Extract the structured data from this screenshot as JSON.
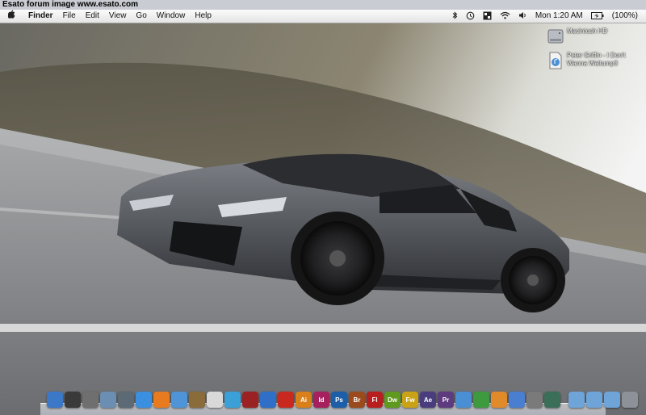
{
  "watermark": "Esato forum image www.esato.com",
  "menubar": {
    "apple": "",
    "app_name": "Finder",
    "menus": [
      "File",
      "Edit",
      "View",
      "Go",
      "Window",
      "Help"
    ],
    "clock": "Mon 1:20 AM",
    "battery": "(100%)"
  },
  "desktop": {
    "icons": [
      {
        "label": "Macintosh HD",
        "icon": "hard-drive-icon"
      },
      {
        "label": "Peter Griffin - I Don't Wanna Waltump3",
        "icon": "audio-file-icon"
      }
    ]
  },
  "dock": {
    "apps": [
      {
        "name": "finder-icon",
        "text": "",
        "color": "#3b78c8"
      },
      {
        "name": "dashboard-icon",
        "text": "",
        "color": "#3a3a3a"
      },
      {
        "name": "system-preferences-icon",
        "text": "",
        "color": "#6f6f6f"
      },
      {
        "name": "preview-icon",
        "text": "",
        "color": "#6b8fb3"
      },
      {
        "name": "application-icon",
        "text": "",
        "color": "#5b6a74"
      },
      {
        "name": "safari-icon",
        "text": "",
        "color": "#3a8fe0"
      },
      {
        "name": "firefox-icon",
        "text": "",
        "color": "#e87b1f"
      },
      {
        "name": "itunes-icon",
        "text": "",
        "color": "#4f94d6"
      },
      {
        "name": "iphoto-icon",
        "text": "",
        "color": "#8a6b3a"
      },
      {
        "name": "ical-icon",
        "text": "",
        "color": "#d9d9d9"
      },
      {
        "name": "quicktime-icon",
        "text": "",
        "color": "#3ba0d8"
      },
      {
        "name": "photo-booth-icon",
        "text": "",
        "color": "#9a2222"
      },
      {
        "name": "bluetooth-icon",
        "text": "",
        "color": "#2f6fc7"
      },
      {
        "name": "acrobat-icon",
        "text": "",
        "color": "#c8281e"
      },
      {
        "name": "illustrator-icon",
        "text": "Ai",
        "color": "#d9801b"
      },
      {
        "name": "indesign-icon",
        "text": "Id",
        "color": "#a5205c"
      },
      {
        "name": "photoshop-icon",
        "text": "Ps",
        "color": "#1c5ea8"
      },
      {
        "name": "bridge-icon",
        "text": "Br",
        "color": "#9a4a1c"
      },
      {
        "name": "flash-icon",
        "text": "Fl",
        "color": "#b81e1e"
      },
      {
        "name": "dreamweaver-icon",
        "text": "Dw",
        "color": "#5f9a1e"
      },
      {
        "name": "fireworks-icon",
        "text": "Fw",
        "color": "#c9a315"
      },
      {
        "name": "after-effects-icon",
        "text": "Ae",
        "color": "#4a3d7e"
      },
      {
        "name": "premiere-icon",
        "text": "Pr",
        "color": "#5e3a7e"
      },
      {
        "name": "utility-icon",
        "text": "",
        "color": "#4a8fd3"
      },
      {
        "name": "network-icon",
        "text": "",
        "color": "#3e9a3e"
      },
      {
        "name": "transmit-icon",
        "text": "",
        "color": "#e08a2a"
      },
      {
        "name": "chat-icon",
        "text": "",
        "color": "#4a7ed0"
      },
      {
        "name": "screen-share-icon",
        "text": "",
        "color": "#7a7a7a"
      },
      {
        "name": "time-machine-icon",
        "text": "",
        "color": "#3b6f5a"
      }
    ],
    "folders": [
      {
        "name": "applications-folder-icon",
        "color": "#6fa4d8"
      },
      {
        "name": "documents-folder-icon",
        "color": "#6fa4d8"
      },
      {
        "name": "downloads-folder-icon",
        "color": "#6fa4d8"
      },
      {
        "name": "trash-icon",
        "color": "#8d9299"
      }
    ]
  }
}
